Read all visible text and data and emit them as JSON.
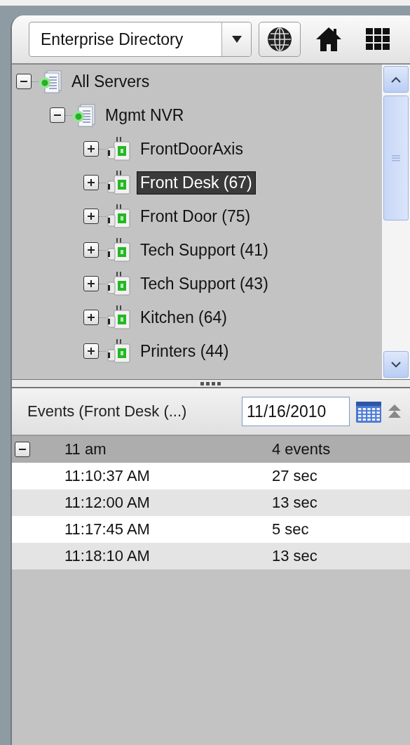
{
  "toolbar": {
    "directory": "Enterprise Directory"
  },
  "tree": [
    {
      "label": "All Servers",
      "kind": "server",
      "expanded": true,
      "selected": false,
      "children": [
        {
          "label": "Mgmt NVR",
          "kind": "server",
          "expanded": true,
          "selected": false,
          "children": [
            {
              "label": "FrontDoorAxis",
              "kind": "camera",
              "expanded": false,
              "selected": false
            },
            {
              "label": "Front Desk (67)",
              "kind": "camera",
              "expanded": false,
              "selected": true
            },
            {
              "label": "Front Door (75)",
              "kind": "camera",
              "expanded": false,
              "selected": false
            },
            {
              "label": "Tech Support (41)",
              "kind": "camera",
              "expanded": false,
              "selected": false
            },
            {
              "label": "Tech Support (43)",
              "kind": "camera",
              "expanded": false,
              "selected": false
            },
            {
              "label": "Kitchen (64)",
              "kind": "camera",
              "expanded": false,
              "selected": false
            },
            {
              "label": "Printers (44)",
              "kind": "camera",
              "expanded": false,
              "selected": false
            }
          ]
        }
      ]
    }
  ],
  "events": {
    "title": "Events (Front Desk (...)",
    "date": "11/16/2010",
    "groups": [
      {
        "label": "11 am",
        "count": "4 events",
        "expanded": true,
        "rows": [
          {
            "time": "11:10:37 AM",
            "duration": "27 sec"
          },
          {
            "time": "11:12:00 AM",
            "duration": "13 sec"
          },
          {
            "time": "11:17:45 AM",
            "duration": "5 sec"
          },
          {
            "time": "11:18:10 AM",
            "duration": "13 sec"
          }
        ]
      }
    ]
  }
}
